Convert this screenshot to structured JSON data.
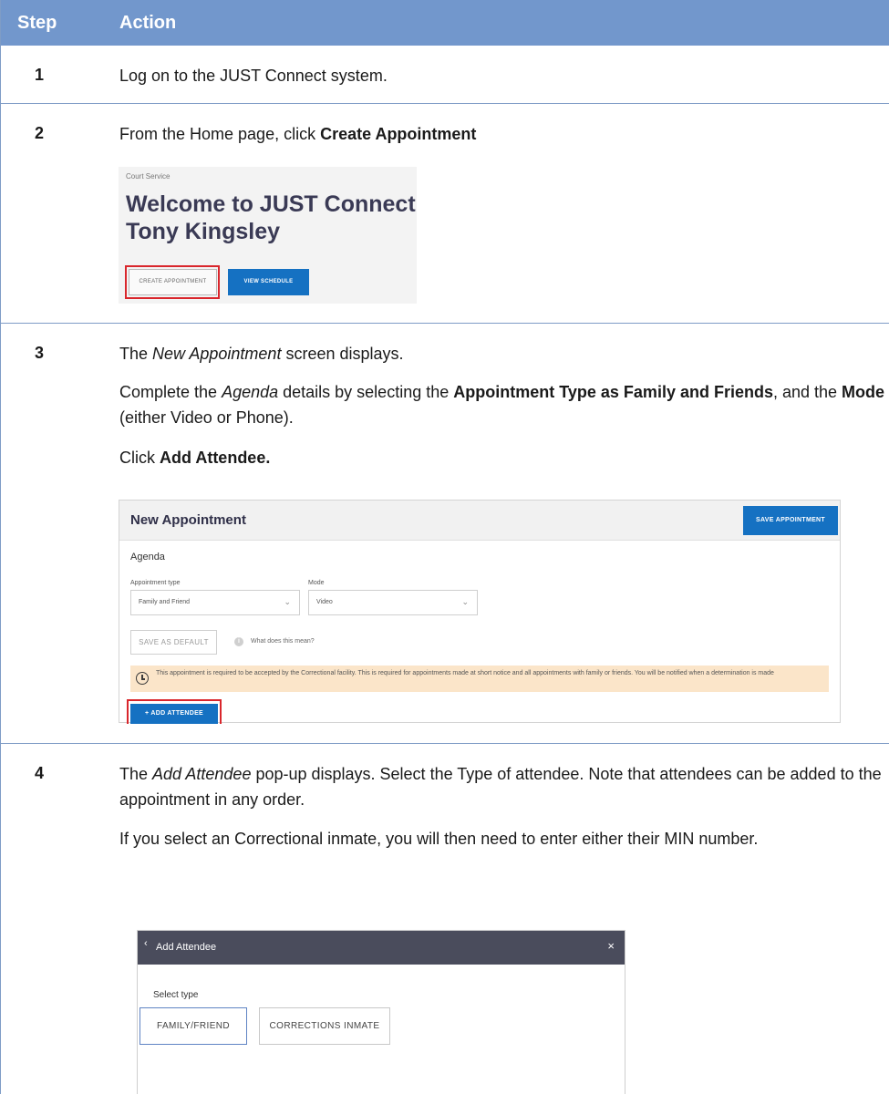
{
  "header": {
    "step": "Step",
    "action": "Action"
  },
  "steps": [
    {
      "num": "1",
      "text": "Log on to the JUST Connect system."
    },
    {
      "num": "2",
      "text_pre": "From the Home page, click ",
      "text_bold": "Create Appointment",
      "screenshot": {
        "breadcrumb": "Court Service",
        "welcome": "Welcome to JUST Connect Tony Kingsley",
        "create_button": "CREATE APPOINTMENT",
        "view_button": "VIEW SCHEDULE"
      }
    },
    {
      "num": "3",
      "p1_italic": "New Appointment",
      "p1_rest": " screen displays.",
      "p1_pre": "The ",
      "p2_a": "Complete the ",
      "p2_agenda": "Agenda",
      "p2_b": " details by selecting the ",
      "p2_type": "Appointment Type as Family and Friends",
      "p2_c": ", and the ",
      "p2_mode": "Mode",
      "p2_d": " (either Video or Phone).",
      "p3_a": "Click ",
      "p3_bold": "Add Attendee.",
      "screenshot": {
        "title": "New Appointment",
        "save_button": "SAVE APPOINTMENT",
        "agenda_label": "Agenda",
        "type_label": "Appointment type",
        "type_value": "Family and Friend",
        "mode_label": "Mode",
        "mode_value": "Video",
        "default_button": "SAVE AS DEFAULT",
        "info_text": "What does this mean?",
        "warning": "This appointment is required to be accepted by the Correctional facility. This is required for appointments made at short notice and all appointments with family or friends. You will be notified when a determination is made",
        "add_button": "+ ADD ATTENDEE"
      }
    },
    {
      "num": "4",
      "p1_pre": "The ",
      "p1_italic": "Add Attendee",
      "p1_rest": " pop-up displays. Select the Type of attendee. Note that attendees can be added to the appointment in any order.",
      "p2": "If you select an Correctional inmate, you will then need to enter either their MIN number.",
      "screenshot": {
        "title": "Add Attendee",
        "select_label": "Select type",
        "option_family": "FAMILY/FRIEND",
        "option_inmate": "CORRECTIONS INMATE"
      }
    }
  ],
  "icons": {
    "back": "chevron-left-icon",
    "close": "close-icon",
    "info": "info-icon",
    "clock": "clock-icon",
    "dropdown": "chevron-down-icon"
  },
  "colors": {
    "header_bg": "#7297cc",
    "button_blue": "#1571c2",
    "highlight_red": "#d9262c",
    "warning_bg": "#fbe5c9",
    "modal_bar": "#4a4c5c"
  }
}
